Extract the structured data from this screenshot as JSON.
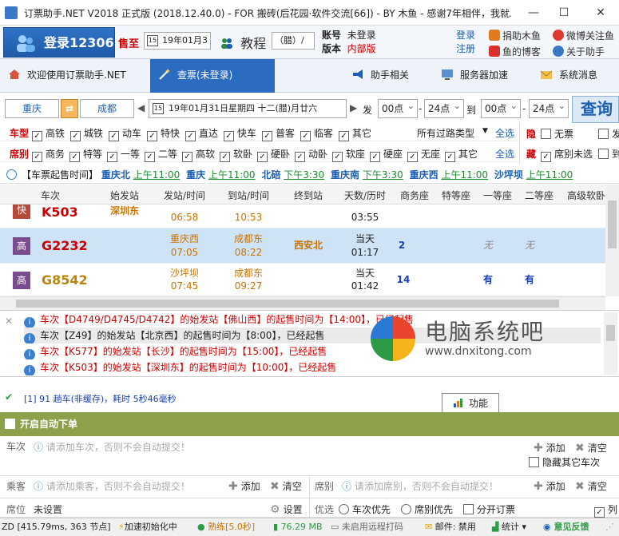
{
  "window": {
    "title": "订票助手.NET V2018 正式版 (2018.12.40.0) - FOR 搬砖(后花园·软件交流[66]) - BY 木鱼 - 感谢7年相伴，我就..."
  },
  "header": {
    "login_label": "登录12306",
    "sell_label": "售至",
    "sell_date": "19年01月3",
    "tutorial_label": "教程",
    "lunar_select": "（腊）/",
    "account_label": "账号",
    "account_value": "未登录",
    "version_label": "版本",
    "version_value": "内部版",
    "login_link": "登录",
    "register_link": "注册",
    "donate_label": "捐助木鱼",
    "weibo_label": "微博关注鱼",
    "blog_label": "鱼的博客",
    "about_label": "关于助手"
  },
  "nav": {
    "items": [
      {
        "label": "欢迎使用订票助手.NET",
        "icon": "home-icon"
      },
      {
        "label": "查票(未登录)",
        "icon": "wand-icon"
      },
      {
        "label": "助手相关",
        "icon": "megaphone-icon"
      },
      {
        "label": "服务器加速",
        "icon": "monitor-icon"
      },
      {
        "label": "系统消息",
        "icon": "envelope-icon"
      }
    ]
  },
  "search": {
    "from": "重庆",
    "to": "成都",
    "date": "19年01月31日星期四 十二(腊)月廿六",
    "depart_label": "发",
    "from_time": "00点",
    "to_time": "24点",
    "until_label": "到",
    "arr_from_time": "00点",
    "arr_to_time": "24点",
    "query_label": "查询"
  },
  "filters": {
    "type_label": "车型",
    "types": [
      {
        "label": "高铁",
        "checked": true
      },
      {
        "label": "城铁",
        "checked": true
      },
      {
        "label": "动车",
        "checked": true
      },
      {
        "label": "特快",
        "checked": true
      },
      {
        "label": "直达",
        "checked": true
      },
      {
        "label": "快车",
        "checked": true
      },
      {
        "label": "普客",
        "checked": true
      },
      {
        "label": "临客",
        "checked": true
      },
      {
        "label": "其它",
        "checked": true
      }
    ],
    "station_type": "所有过路类型",
    "select_all": "全选",
    "seat_label": "席别",
    "seats": [
      {
        "label": "商务",
        "checked": true
      },
      {
        "label": "特等",
        "checked": true
      },
      {
        "label": "一等",
        "checked": true
      },
      {
        "label": "二等",
        "checked": true
      },
      {
        "label": "高软",
        "checked": true
      },
      {
        "label": "软卧",
        "checked": true
      },
      {
        "label": "硬卧",
        "checked": true
      },
      {
        "label": "动卧",
        "checked": true
      },
      {
        "label": "软座",
        "checked": true
      },
      {
        "label": "硬座",
        "checked": true
      },
      {
        "label": "无座",
        "checked": true
      },
      {
        "label": "其它",
        "checked": true
      }
    ],
    "select_all2": "全选",
    "hide_label": "隐",
    "hide_option": "无票",
    "hide_option2": "发",
    "hide_label2": "藏",
    "hide_option3": "席别未选",
    "hide_option4": "到"
  },
  "sale_times": {
    "label": "【车票起售时间】",
    "entries": [
      {
        "station": "重庆北",
        "time": "上午11:00"
      },
      {
        "station": "重庆",
        "time": "上午11:00"
      },
      {
        "station": "北碚",
        "time": "下午3:30"
      },
      {
        "station": "重庆南",
        "time": "下午3:30"
      },
      {
        "station": "重庆西",
        "time": "上午11:00"
      },
      {
        "station": "沙坪坝",
        "time": "上午11:00"
      }
    ]
  },
  "table": {
    "headers": [
      "车次",
      "始发站",
      "发站/时间",
      "到站/时间",
      "终到站",
      "天数/历时",
      "商务座",
      "特等座",
      "一等座",
      "二等座",
      "高级软卧"
    ],
    "rows": [
      {
        "badge": "快",
        "train": "K503",
        "train_color": "red",
        "origin": "深圳东",
        "dep_station": "",
        "dep_time": "06:58",
        "arr_station": "",
        "arr_time": "10:53",
        "terminal": "",
        "days": "",
        "duration": "03:55",
        "business": "",
        "premium": "",
        "first": "",
        "second": ""
      },
      {
        "badge": "高",
        "train": "G2232",
        "train_color": "red",
        "origin": "",
        "dep_station": "重庆西",
        "dep_time": "07:05",
        "arr_station": "成都东",
        "arr_time": "08:22",
        "terminal": "西安北",
        "days": "当天",
        "duration": "01:17",
        "business": "2",
        "premium": "",
        "first": "无",
        "second": "无"
      },
      {
        "badge": "高",
        "train": "G8542",
        "train_color": "gold",
        "origin": "",
        "dep_station": "沙坪坝",
        "dep_time": "07:45",
        "arr_station": "成都东",
        "arr_time": "09:27",
        "terminal": "",
        "days": "当天",
        "duration": "01:42",
        "business": "14",
        "premium": "",
        "first": "有",
        "second": "有"
      }
    ]
  },
  "log": {
    "lines": [
      {
        "text": "车次【D4749/D4745/D4742】的始发站【佛山西】的起售时间为【14:00】，已经起售",
        "color": "red"
      },
      {
        "text": "车次【Z49】的始发站【北京西】的起售时间为【8:00】，已经起售",
        "color": "black"
      },
      {
        "text": "车次【K577】的始发站【长沙】的起售时间为【15:00】，已经起售",
        "color": "red"
      },
      {
        "text": "车次【K503】的始发站【深圳东】的起售时间为【10:00】，已经起售",
        "color": "red"
      }
    ]
  },
  "status_line": {
    "text": "[1] 91 趟车(非缓存)，耗时 5秒46毫秒",
    "func_label": "功能"
  },
  "auto_order": {
    "header": "开启自动下单",
    "train_label": "车次",
    "train_placeholder": "请添加车次，否则不会自动提交！",
    "add_label": "添加",
    "clear_label": "清空",
    "hide_other": "隐藏其它车次",
    "passenger_label": "乘客",
    "passenger_placeholder": "请添加乘客，否则不会自动提交！",
    "seat_label": "席别",
    "seat_placeholder": "请添加席别，否则不会自动提交！",
    "position_label": "席位",
    "position_value": "未设置",
    "settings_label": "设置",
    "priority_label": "优选",
    "priority_train": "车次优先",
    "priority_seat": "席别优先",
    "split_order": "分开订票",
    "last_clip": "列"
  },
  "statusbar": {
    "zd": "ZD [415.79ms, 363 节点]",
    "speed": "加速初始化中",
    "cooldown": "熟练[5.0秒]",
    "memory": "76.29 MB",
    "remote": "未启用远程打码",
    "mail": "邮件: 禁用",
    "stats": "统计",
    "feedback": "意见反馈"
  },
  "watermark": {
    "brand": "电脑系统吧",
    "url": "www.dnxitong.com"
  },
  "colors": {
    "accent": "#2b6cc1",
    "train_red": "#cc0000",
    "train_gold": "#b8860b",
    "auto_header": "#8da04a"
  }
}
